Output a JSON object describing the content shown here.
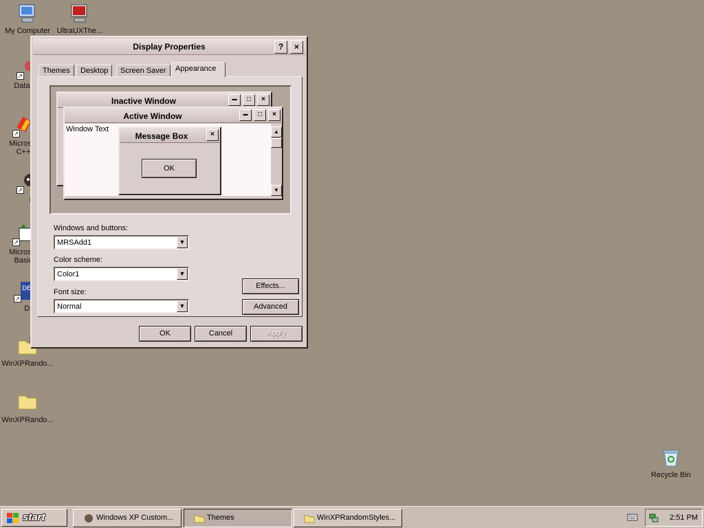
{
  "desktop": {
    "icons": [
      {
        "label": "My Computer"
      },
      {
        "label": "UltraUXThe..."
      },
      {
        "label": "DataWa"
      },
      {
        "label": "Microsof"
      },
      {
        "label": "C++ "
      },
      {
        "label": "Myp"
      },
      {
        "label": "Microsof"
      },
      {
        "label": "Basic"
      },
      {
        "label": "Dev-"
      },
      {
        "label": "WinXPRando..."
      },
      {
        "label": "WinXPRando..."
      },
      {
        "label": "Recycle Bin"
      }
    ]
  },
  "dialog": {
    "title": "Display Properties",
    "help_btn": "?",
    "close_btn": "×",
    "tabs": [
      {
        "label": "Themes"
      },
      {
        "label": "Desktop"
      },
      {
        "label": "Screen Saver"
      },
      {
        "label": "Appearance"
      }
    ],
    "preview": {
      "inactive_title": "Inactive Window",
      "active_title": "Active Window",
      "window_text": "Window Text",
      "msgbox_title": "Message Box",
      "msgbox_ok": "OK",
      "min_glyph": "▬",
      "max_glyph": "□",
      "close_glyph": "×"
    },
    "fields": {
      "windows_buttons_label": "Windows and buttons:",
      "windows_buttons_value": "MRSAdd1",
      "color_scheme_label": "Color scheme:",
      "color_scheme_value": "Color1",
      "font_size_label": "Font size:",
      "font_size_value": "Normal"
    },
    "buttons": {
      "effects": "Effects...",
      "advanced": "Advanced",
      "ok": "OK",
      "cancel": "Cancel",
      "apply": "Apply"
    }
  },
  "taskbar": {
    "start": "start",
    "items": [
      {
        "label": "Windows XP Custom..."
      },
      {
        "label": "Themes"
      },
      {
        "label": "WinXPRandomStyles..."
      }
    ],
    "clock": "2:51 PM"
  },
  "colors": {
    "desktop": "#9c9080",
    "dialog_face": "#d9cdcb",
    "window_bg": "#fdf6f6"
  }
}
